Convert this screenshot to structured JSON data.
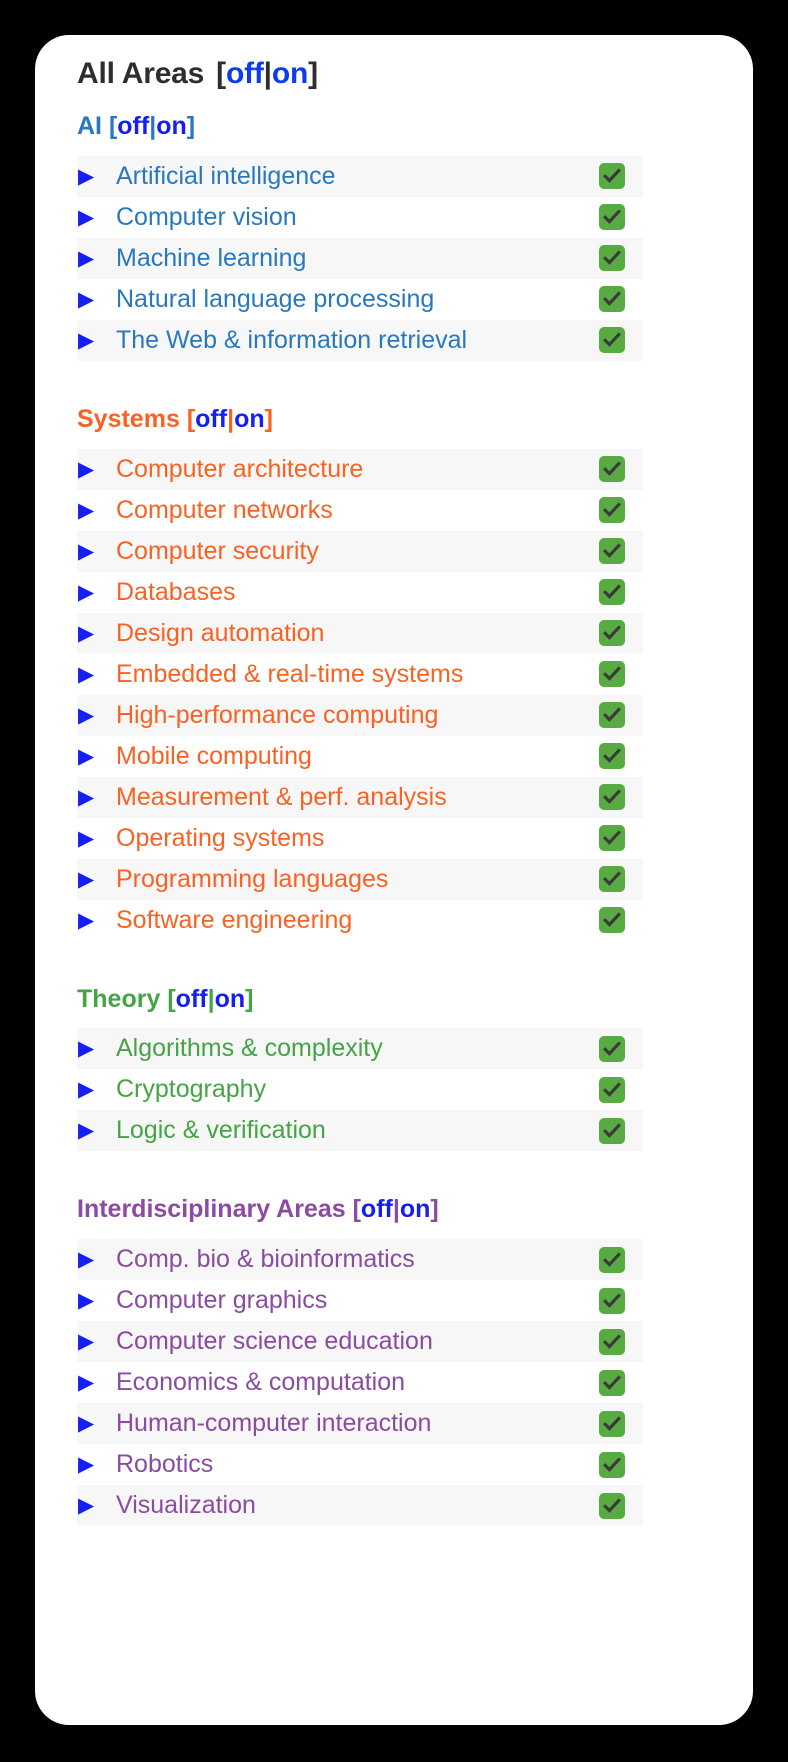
{
  "master": {
    "title": "All Areas",
    "off_label": "off",
    "separator": "|",
    "on_label": "on",
    "open_bracket": "[",
    "close_bracket": "]"
  },
  "toggle": {
    "off_label": "off",
    "on_label": "on",
    "separator": "|",
    "open_bracket": "[",
    "close_bracket": "]"
  },
  "icons": {
    "expand_triangle": "▶",
    "checkbox_check": "check-icon"
  },
  "colors": {
    "ai": "#2878c0",
    "systems": "#f96222",
    "theory": "#44a446",
    "interdisciplinary": "#8b4ba0",
    "link": "#1520ef",
    "checkbox": "#58ab43",
    "checkmark": "#3a3a3a",
    "stripe": "#f7f7f7",
    "card": "#ffffff",
    "page": "#000000",
    "title": "#2e2e2e"
  },
  "groups": [
    {
      "id": "ai",
      "name": "AI",
      "items": [
        {
          "label": "Artificial intelligence",
          "checked": true
        },
        {
          "label": "Computer vision",
          "checked": true
        },
        {
          "label": "Machine learning",
          "checked": true
        },
        {
          "label": "Natural language processing",
          "checked": true
        },
        {
          "label": "The Web & information retrieval",
          "checked": true
        }
      ]
    },
    {
      "id": "systems",
      "name": "Systems",
      "items": [
        {
          "label": "Computer architecture",
          "checked": true
        },
        {
          "label": "Computer networks",
          "checked": true
        },
        {
          "label": "Computer security",
          "checked": true
        },
        {
          "label": "Databases",
          "checked": true
        },
        {
          "label": "Design automation",
          "checked": true
        },
        {
          "label": "Embedded & real-time systems",
          "checked": true
        },
        {
          "label": "High-performance computing",
          "checked": true
        },
        {
          "label": "Mobile computing",
          "checked": true
        },
        {
          "label": "Measurement & perf. analysis",
          "checked": true
        },
        {
          "label": "Operating systems",
          "checked": true
        },
        {
          "label": "Programming languages",
          "checked": true
        },
        {
          "label": "Software engineering",
          "checked": true
        }
      ]
    },
    {
      "id": "theory",
      "name": "Theory",
      "items": [
        {
          "label": "Algorithms & complexity",
          "checked": true
        },
        {
          "label": "Cryptography",
          "checked": true
        },
        {
          "label": "Logic & verification",
          "checked": true
        }
      ]
    },
    {
      "id": "interdisciplinary",
      "name": "Interdisciplinary Areas",
      "items": [
        {
          "label": "Comp. bio & bioinformatics",
          "checked": true
        },
        {
          "label": "Computer graphics",
          "checked": true
        },
        {
          "label": "Computer science education",
          "checked": true
        },
        {
          "label": "Economics & computation",
          "checked": true
        },
        {
          "label": "Human-computer interaction",
          "checked": true
        },
        {
          "label": "Robotics",
          "checked": true
        },
        {
          "label": "Visualization",
          "checked": true
        }
      ]
    }
  ]
}
